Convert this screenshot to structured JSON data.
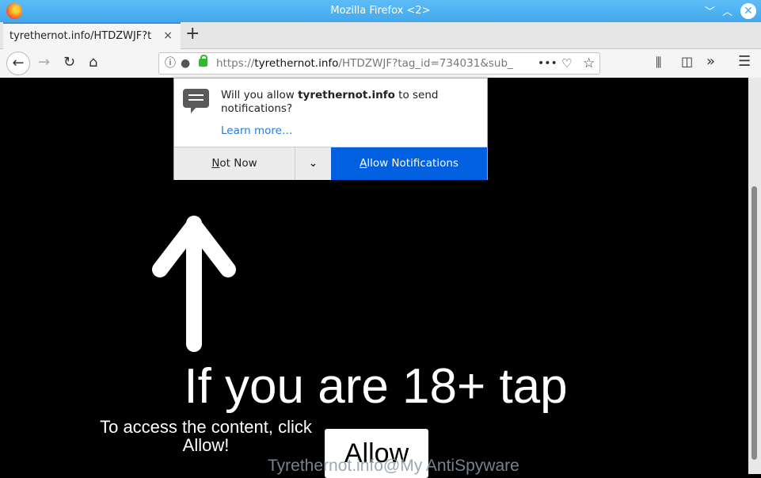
{
  "window": {
    "title": "Mozilla Firefox <2>"
  },
  "tab": {
    "label": "tyrethernot.info/HTDZWJF?t",
    "close": "×",
    "new_tab": "+"
  },
  "urlbar": {
    "scheme": "https://",
    "domain": "tyrethernot.info",
    "path": "/HTDZWJF?tag_id=734031&sub_"
  },
  "popup": {
    "msg_pre": "Will you allow ",
    "msg_domain": "tyrethernot.info",
    "msg_post": " to send notifications?",
    "learn_more": "Learn more…",
    "not_now_u": "N",
    "not_now_rest": "ot Now",
    "allow_u": "A",
    "allow_rest": "llow Notifications"
  },
  "page": {
    "headline": "If you are 18+ tap",
    "access_text": "To access the content, click Allow!",
    "allow_button": "Allow",
    "watermark": "Tyrethernot.info@My AntiSpyware"
  },
  "colors": {
    "accent": "#0060df",
    "titlebar": "#4fb1f0",
    "secure_lock": "#2dbb29"
  }
}
